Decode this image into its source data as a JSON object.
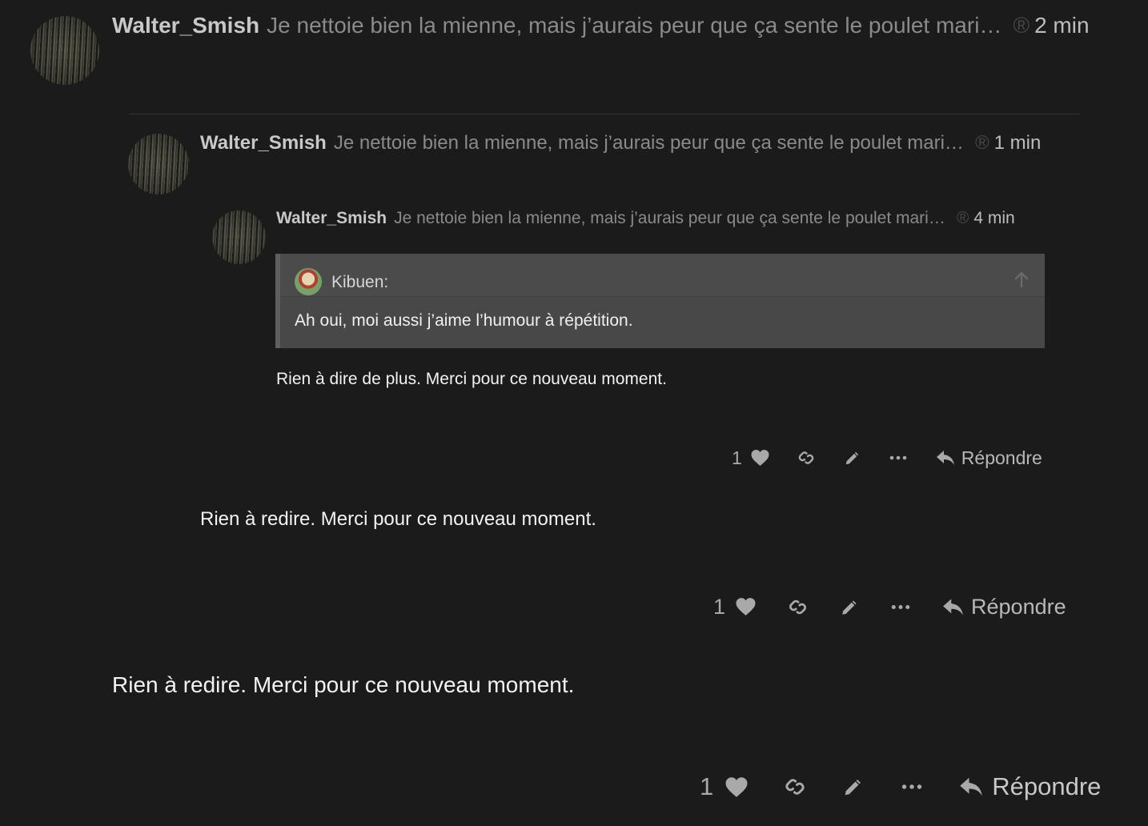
{
  "posts": [
    {
      "username": "Walter_Smish",
      "excerpt": "Je nettoie bien la mienne, mais j’aurais peur que ça sente le poulet mari…",
      "reg_symbol": "®",
      "time": "2 min",
      "body": "Rien à redire. Merci pour ce nouveau moment.",
      "likes": "1",
      "reply_label": "Répondre"
    },
    {
      "username": "Walter_Smish",
      "excerpt": "Je nettoie bien la mienne, mais j’aurais peur que ça sente le poulet mari…",
      "reg_symbol": "®",
      "time": "1 min",
      "body": "Rien à redire. Merci pour ce nouveau moment.",
      "likes": "1",
      "reply_label": "Répondre"
    },
    {
      "username": "Walter_Smish",
      "excerpt": "Je nettoie bien la mienne, mais j’aurais peur que ça sente le poulet mari…",
      "reg_symbol": "®",
      "time": "4 min",
      "quote": {
        "author": "Kibuen:",
        "text": "Ah oui, moi aussi j’aime l’humour à répétition."
      },
      "body": "Rien à dire de plus. Merci pour ce nouveau moment.",
      "likes": "1",
      "reply_label": "Répondre"
    }
  ],
  "icons": {
    "like": "heart-icon",
    "link": "link-icon",
    "edit": "pencil-icon",
    "more": "ellipsis-icon",
    "reply": "reply-arrow-icon"
  },
  "colors": {
    "background": "#1b1b1b",
    "quote_background": "#484848",
    "username": "#c8c8c8",
    "excerpt": "#8a8a8a"
  }
}
